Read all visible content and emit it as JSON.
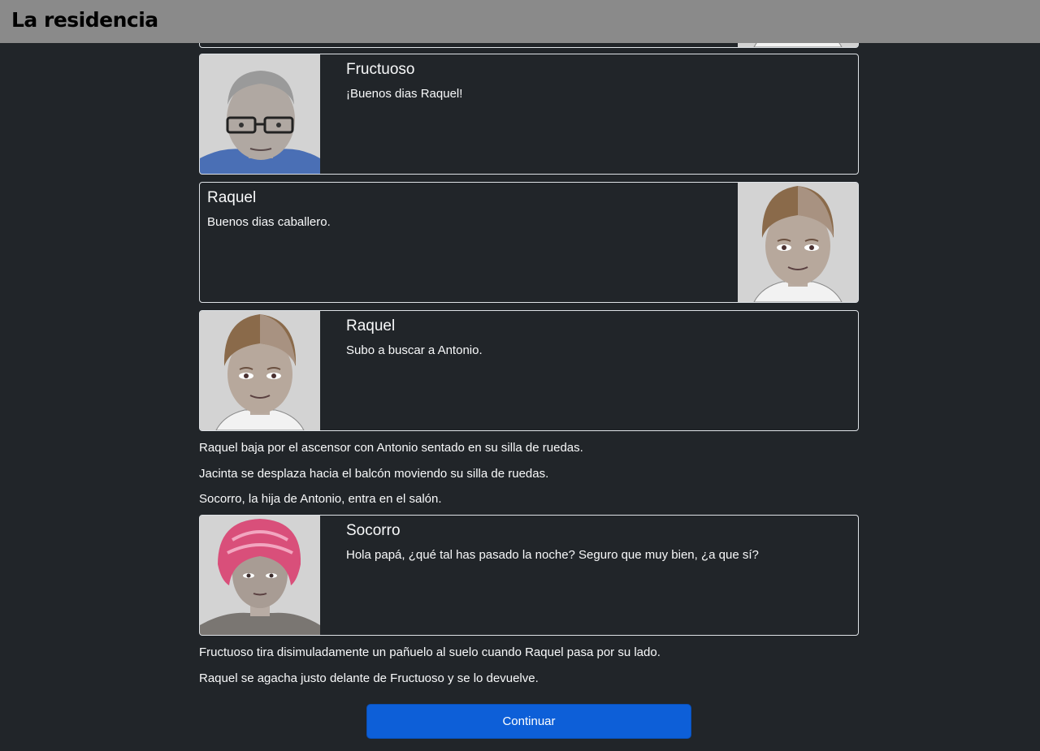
{
  "app": {
    "title": "La residencia"
  },
  "dialogues": [
    {
      "speaker": "",
      "text": "",
      "portrait": "raquel-portrait",
      "side": "right"
    },
    {
      "speaker": "Fructuoso",
      "text": "¡Buenos dias Raquel!",
      "portrait": "fructuoso-portrait",
      "side": "left"
    },
    {
      "speaker": "Raquel",
      "text": "Buenos dias caballero.",
      "portrait": "raquel-portrait",
      "side": "right"
    },
    {
      "speaker": "Raquel",
      "text": "Subo a buscar a Antonio.",
      "portrait": "raquel-portrait",
      "side": "left"
    },
    {
      "speaker": "Socorro",
      "text": "Hola papá, ¿qué tal has pasado la noche? Seguro que muy bien, ¿a que sí?",
      "portrait": "socorro-portrait",
      "side": "left"
    }
  ],
  "narration": [
    "Raquel baja por el ascensor con Antonio sentado en su silla de ruedas.",
    "Jacinta se desplaza hacia el balcón moviendo su silla de ruedas.",
    "Socorro, la hija de Antonio, entra en el salón.",
    "Fructuoso tira disimuladamente un pañuelo al suelo cuando Raquel pasa por su lado.",
    "Raquel se agacha justo delante de Fructuoso y se lo devuelve."
  ],
  "actions": {
    "continue_label": "Continuar"
  },
  "colors": {
    "background": "#212529",
    "topbar": "#8a8a8a",
    "button": "#0d5fd8",
    "border": "#dee2e6"
  }
}
